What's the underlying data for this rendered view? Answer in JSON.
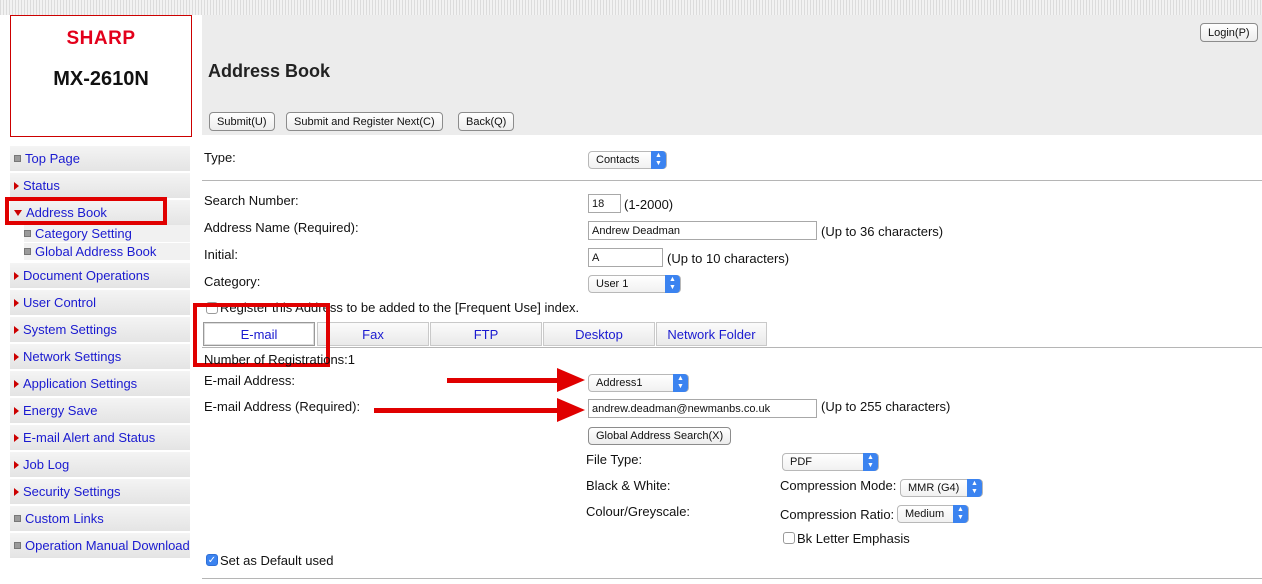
{
  "brand": {
    "name": "SHARP",
    "model": "MX-2610N"
  },
  "header": {
    "login_label": "Login(P)",
    "title": "Address Book"
  },
  "toolbar": {
    "submit": "Submit(U)",
    "submit_next": "Submit and Register Next(C)",
    "back": "Back(Q)"
  },
  "sidebar": {
    "items": [
      {
        "label": "Top Page",
        "icon": "square-bullet-icon"
      },
      {
        "label": "Status",
        "icon": "triangle-right-icon"
      },
      {
        "label": "Address Book",
        "icon": "triangle-down-icon"
      },
      {
        "label": "Document Operations",
        "icon": "triangle-right-icon"
      },
      {
        "label": "User Control",
        "icon": "triangle-right-icon"
      },
      {
        "label": "System Settings",
        "icon": "triangle-right-icon"
      },
      {
        "label": "Network Settings",
        "icon": "triangle-right-icon"
      },
      {
        "label": "Application Settings",
        "icon": "triangle-right-icon"
      },
      {
        "label": "Energy Save",
        "icon": "triangle-right-icon"
      },
      {
        "label": "E-mail Alert and Status",
        "icon": "triangle-right-icon"
      },
      {
        "label": "Job Log",
        "icon": "triangle-right-icon"
      },
      {
        "label": "Security Settings",
        "icon": "triangle-right-icon"
      },
      {
        "label": "Custom Links",
        "icon": "square-bullet-icon"
      },
      {
        "label": "Operation Manual Download",
        "icon": "square-bullet-icon"
      }
    ],
    "subitems": [
      {
        "label": "Category Setting"
      },
      {
        "label": "Global Address Book"
      }
    ]
  },
  "form": {
    "type_label": "Type:",
    "type_value": "Contacts",
    "search_number_label": "Search Number:",
    "search_number_value": "18",
    "search_number_range": "(1-2000)",
    "address_name_label": "Address Name (Required):",
    "address_name_value": "Andrew Deadman",
    "address_name_hint": "(Up to 36 characters)",
    "initial_label": "Initial:",
    "initial_value": "A",
    "initial_hint": "(Up to 10 characters)",
    "category_label": "Category:",
    "category_value": "User 1",
    "frequent_label": "Register this Address to be added to the [Frequent Use] index."
  },
  "tabs": [
    {
      "label": "E-mail",
      "active": true
    },
    {
      "label": "Fax",
      "active": false
    },
    {
      "label": "FTP",
      "active": false
    },
    {
      "label": "Desktop",
      "active": false
    },
    {
      "label": "Network Folder",
      "active": false
    }
  ],
  "email": {
    "registrations_label": "Number of Registrations:1",
    "address_label": "E-mail Address:",
    "address_select": "Address1",
    "address_required_label": "E-mail Address (Required):",
    "address_value": "andrew.deadman@newmanbs.co.uk",
    "address_hint": "(Up to 255 characters)",
    "global_search_button": "Global Address Search(X)",
    "file_type_label": "File Type:",
    "file_type_value": "PDF",
    "bw_label": "Black & White:",
    "compression_mode_label": "Compression Mode:",
    "compression_mode_value": "MMR (G4)",
    "colour_label": "Colour/Greyscale:",
    "compression_ratio_label": "Compression Ratio:",
    "compression_ratio_value": "Medium",
    "bk_letter_label": "Bk Letter Emphasis",
    "default_label": "Set as Default used"
  },
  "colors": {
    "accent": "#e00000",
    "link": "#1a1ad0",
    "select_arrow": "#3b83f0",
    "header_bg": "#ececec"
  }
}
